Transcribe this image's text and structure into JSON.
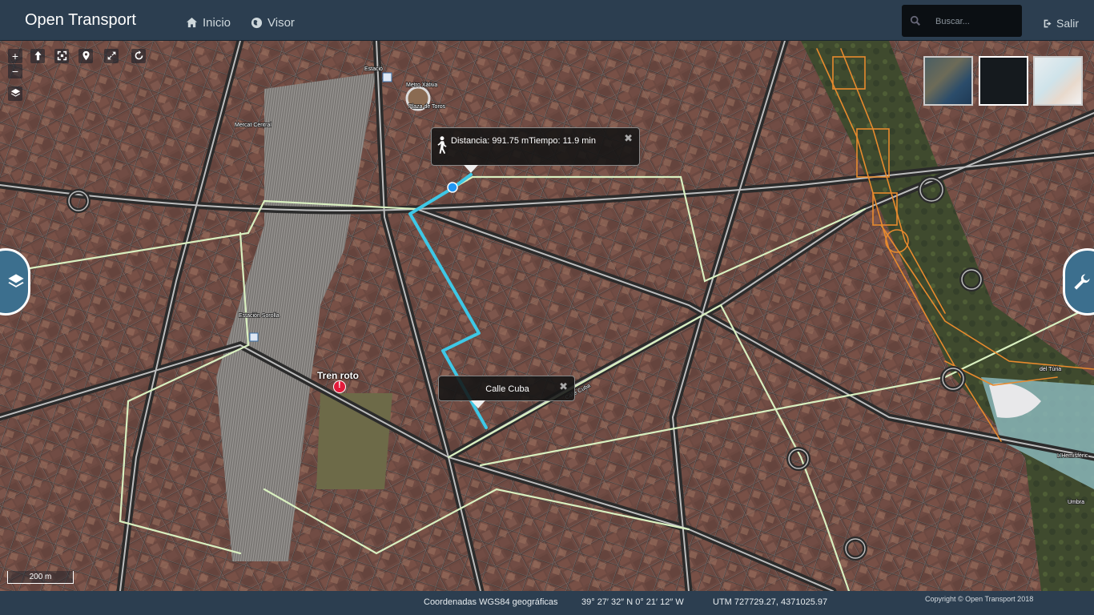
{
  "app": {
    "brand": "Open Transport"
  },
  "nav": {
    "home_label": "Inicio",
    "viewer_label": "Visor"
  },
  "search": {
    "placeholder": "Buscar..."
  },
  "logout": {
    "label": "Salir"
  },
  "map": {
    "controls": {
      "zoom_in": "+",
      "zoom_out": "−"
    },
    "streets": [
      "Estació",
      "Metro Xàtiva",
      "Plaza de Toros",
      "Mercat Central",
      "Estación Sorolla",
      "Calle Cuba",
      "del Túria",
      "L'Hemisfèric",
      "Umbra"
    ],
    "route_popup": {
      "icon": "walking-person-icon",
      "text": "Distancia: 991.75 mTiempo: 11.9 min"
    },
    "destination_popup": {
      "text": "Calle Cuba"
    },
    "incident": {
      "label": "Tren roto",
      "icon_text": "!"
    },
    "scale_label": "200 m",
    "colors": {
      "route": "#3ec8e6",
      "incident": "#e31b3b",
      "bike_lane": "#d9f0c0",
      "green_area": "#e88a2d"
    }
  },
  "footer": {
    "coords_label": "Coordenadas WGS84 geográficas",
    "coords_value": "39° 27′ 32″ N 0° 21′ 12″ W",
    "utm": "UTM 727729.27, 4371025.97",
    "copyright": "Copyright © Open Transport 2018"
  }
}
